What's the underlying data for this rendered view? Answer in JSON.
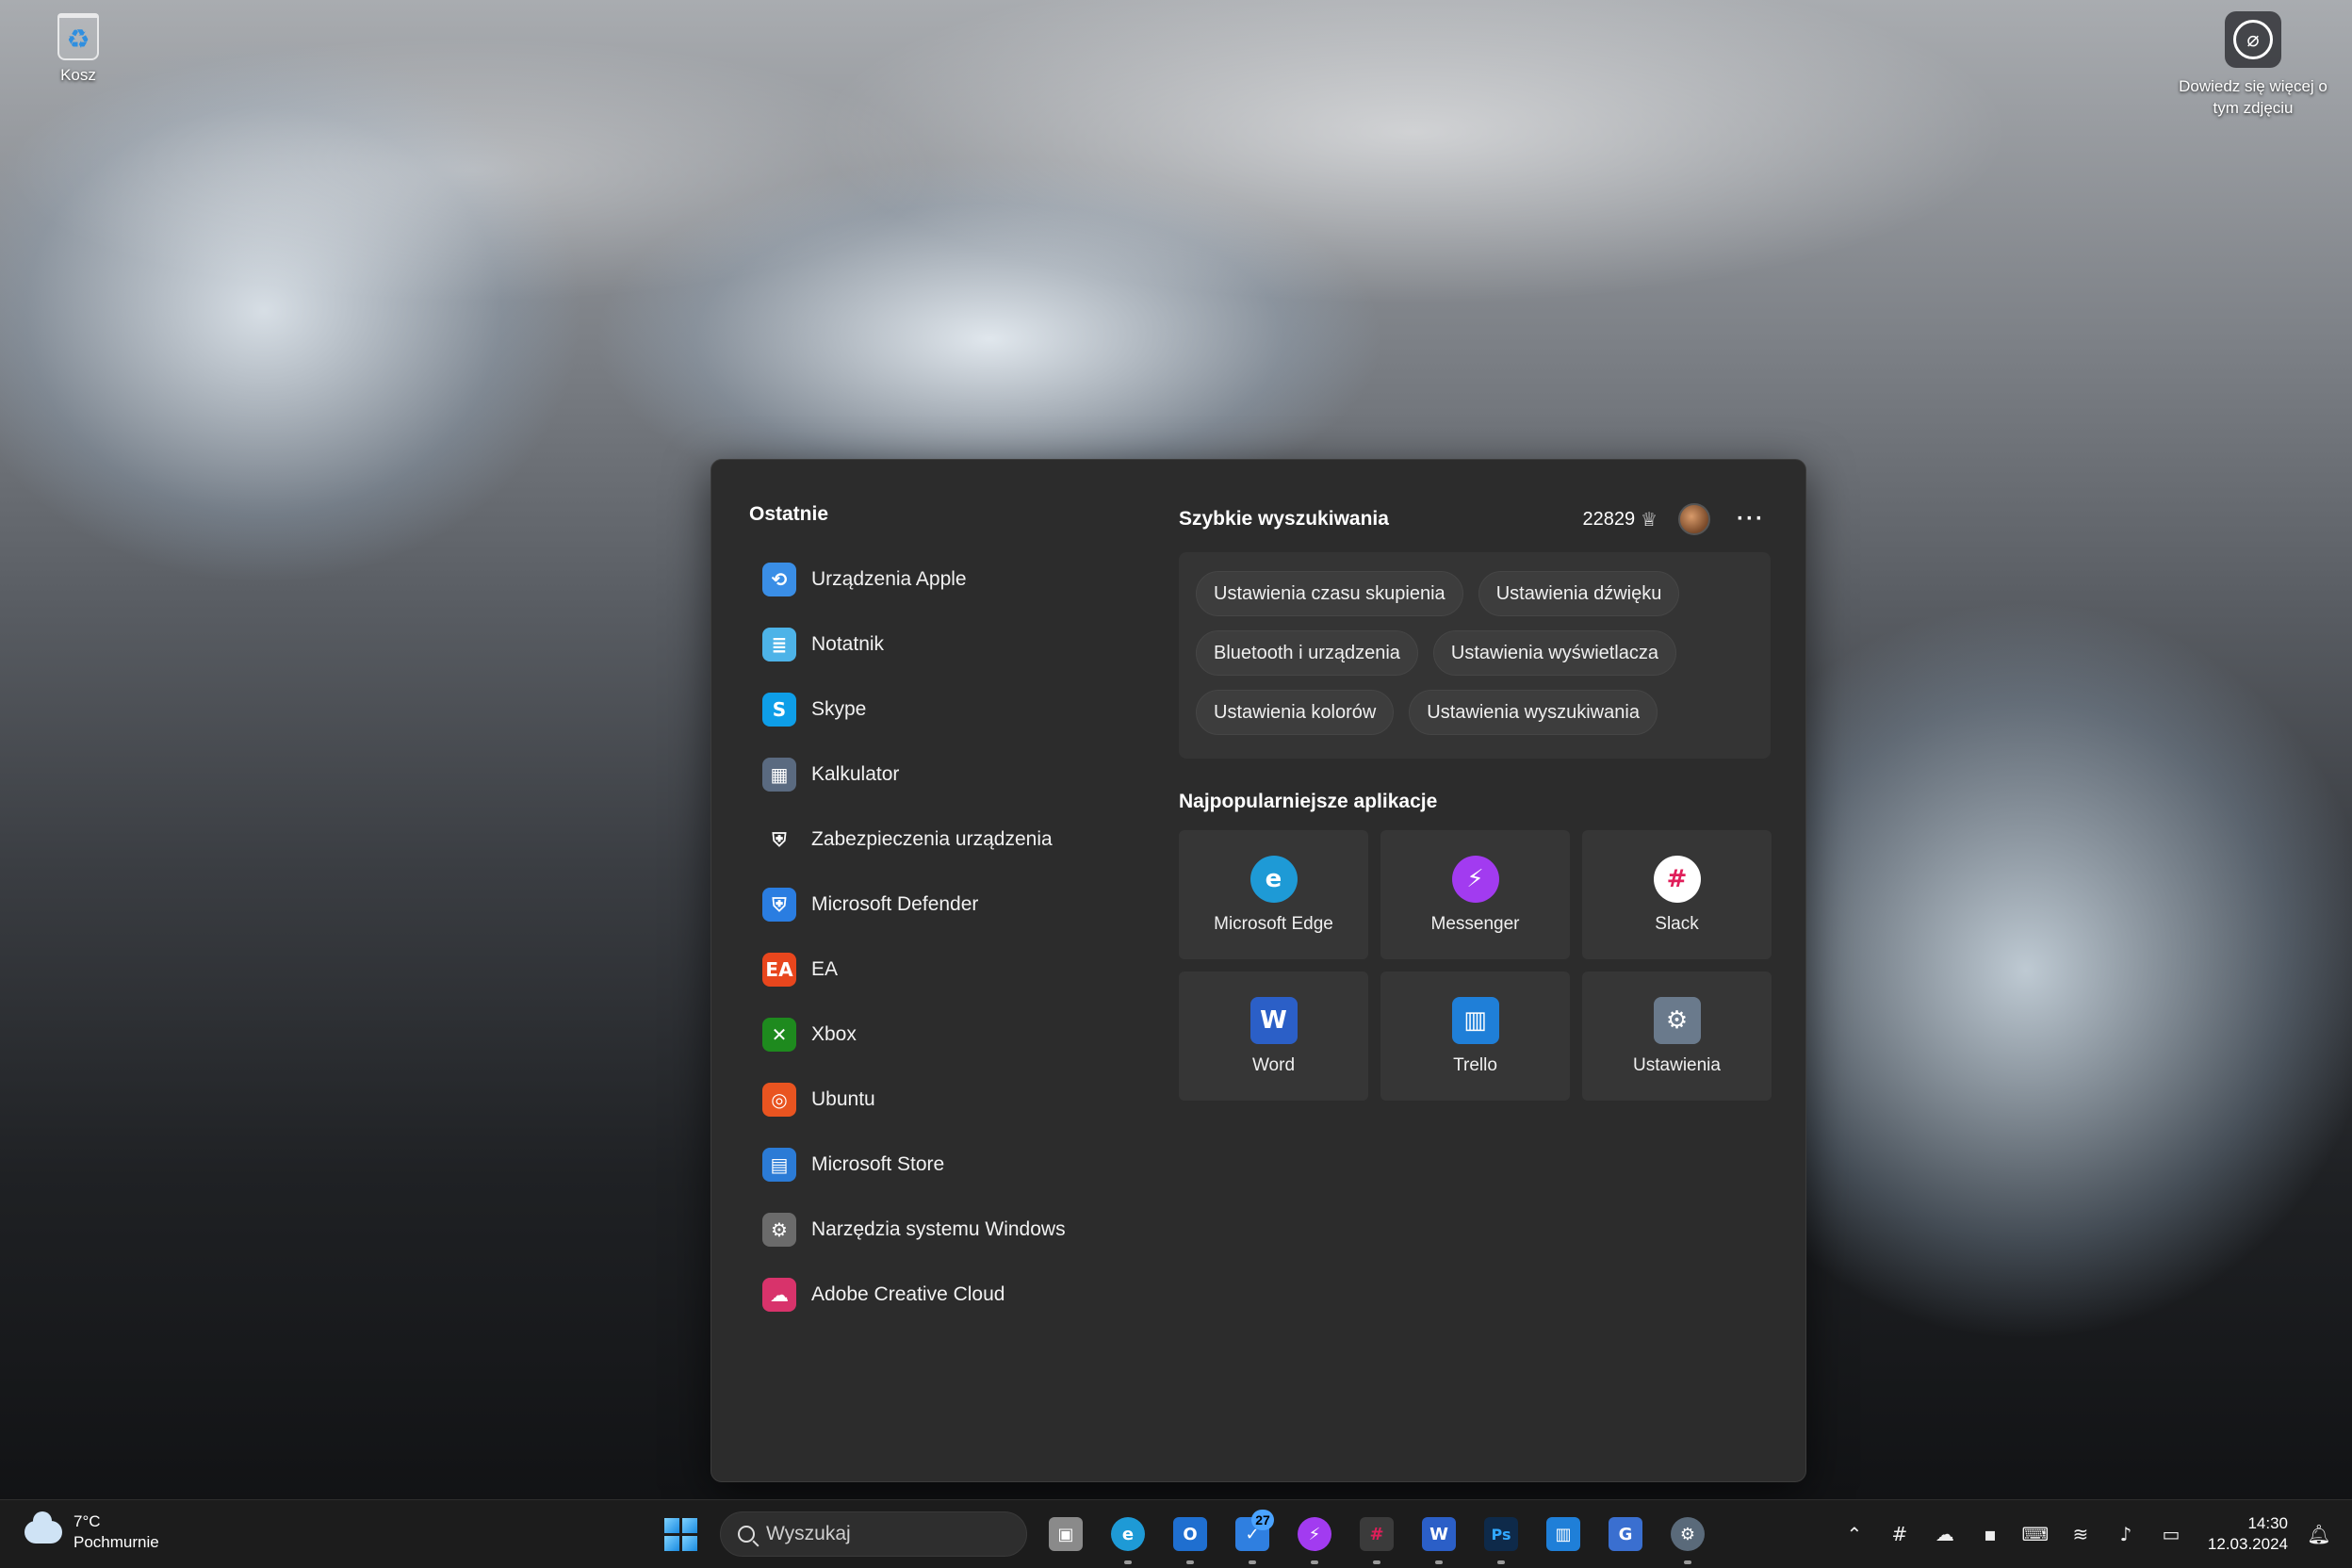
{
  "desktop": {
    "recycle_bin_label": "Kosz",
    "learn_more_label": "Dowiedz się więcej o tym zdjęciu"
  },
  "start_menu": {
    "recent_title": "Ostatnie",
    "recent_items": [
      {
        "label": "Urządzenia Apple",
        "icon": "apple-devices-icon",
        "color": "#3a8ee6",
        "glyph": "⟲"
      },
      {
        "label": "Notatnik",
        "icon": "notepad-icon",
        "color": "#4db3e8",
        "glyph": "≣"
      },
      {
        "label": "Skype",
        "icon": "skype-icon",
        "color": "#0e9ee8",
        "glyph": "S"
      },
      {
        "label": "Kalkulator",
        "icon": "calculator-icon",
        "color": "#5a6a80",
        "glyph": "▦"
      },
      {
        "label": "Zabezpieczenia urządzenia",
        "icon": "shield-icon",
        "color": "#2c2c2c",
        "glyph": "⛨"
      },
      {
        "label": "Microsoft Defender",
        "icon": "defender-icon",
        "color": "#2a7de1",
        "glyph": "⛨"
      },
      {
        "label": "EA",
        "icon": "ea-icon",
        "color": "#e8461d",
        "glyph": "EA"
      },
      {
        "label": "Xbox",
        "icon": "xbox-icon",
        "color": "#1e8a1e",
        "glyph": "✕"
      },
      {
        "label": "Ubuntu",
        "icon": "ubuntu-icon",
        "color": "#e95420",
        "glyph": "◎"
      },
      {
        "label": "Microsoft Store",
        "icon": "store-icon",
        "color": "#2b7bd6",
        "glyph": "▤"
      },
      {
        "label": "Narzędzia systemu Windows",
        "icon": "windows-tools-icon",
        "color": "#6b6b6b",
        "glyph": "⚙"
      },
      {
        "label": "Adobe Creative Cloud",
        "icon": "creative-cloud-icon",
        "color": "#d8336b",
        "glyph": "☁"
      }
    ],
    "quick_search_title": "Szybkie wyszukiwania",
    "points": "22829",
    "quick_searches": [
      "Ustawienia czasu skupienia",
      "Ustawienia dźwięku",
      "Bluetooth i urządzenia",
      "Ustawienia wyświetlacza",
      "Ustawienia kolorów",
      "Ustawienia wyszukiwania"
    ],
    "top_apps_title": "Najpopularniejsze aplikacje",
    "top_apps": [
      {
        "label": "Microsoft Edge",
        "icon": "edge-icon",
        "color": "#1e9ad6",
        "glyph": "e"
      },
      {
        "label": "Messenger",
        "icon": "messenger-icon",
        "color": "#a23bf0",
        "glyph": "⚡"
      },
      {
        "label": "Slack",
        "icon": "slack-icon",
        "color": "#ffffff",
        "glyph": "#"
      },
      {
        "label": "Word",
        "icon": "word-icon",
        "color": "#2b5fc7",
        "glyph": "W"
      },
      {
        "label": "Trello",
        "icon": "trello-icon",
        "color": "#1f7fd8",
        "glyph": "▥"
      },
      {
        "label": "Ustawienia",
        "icon": "settings-icon",
        "color": "#6a7a8c",
        "glyph": "⚙"
      }
    ]
  },
  "taskbar": {
    "weather_temp": "7°C",
    "weather_desc": "Pochmurnie",
    "search_placeholder": "Wyszukaj",
    "pinned": [
      {
        "icon": "task-view-icon",
        "color": "#8a8a8a",
        "glyph": "▣",
        "badge": ""
      },
      {
        "icon": "edge-icon",
        "color": "#1e9ad6",
        "glyph": "e",
        "badge": ""
      },
      {
        "icon": "outlook-icon",
        "color": "#1f6fd0",
        "glyph": "O",
        "badge": ""
      },
      {
        "icon": "todo-icon",
        "color": "#2f7fe0",
        "glyph": "✓",
        "badge": "27"
      },
      {
        "icon": "messenger-icon",
        "color": "#a23bf0",
        "glyph": "⚡",
        "badge": ""
      },
      {
        "icon": "slack-icon",
        "color": "#3b3b3b",
        "glyph": "#",
        "badge": ""
      },
      {
        "icon": "word-icon",
        "color": "#2b5fc7",
        "glyph": "W",
        "badge": ""
      },
      {
        "icon": "photoshop-icon",
        "color": "#0e2a4a",
        "glyph": "Ps",
        "badge": ""
      },
      {
        "icon": "trello-icon",
        "color": "#1f7fd8",
        "glyph": "▥",
        "badge": ""
      },
      {
        "icon": "translator-icon",
        "color": "#3a6fd0",
        "glyph": "G",
        "badge": ""
      },
      {
        "icon": "settings-icon",
        "color": "#5a6a7a",
        "glyph": "⚙",
        "badge": ""
      }
    ],
    "time": "14:30",
    "date": "12.03.2024"
  },
  "colors": {
    "menu_bg": "#2c2c2c",
    "tile_bg": "#363636",
    "taskbar_bg": "#1c1c1c",
    "accent": "#4aa3ff"
  }
}
